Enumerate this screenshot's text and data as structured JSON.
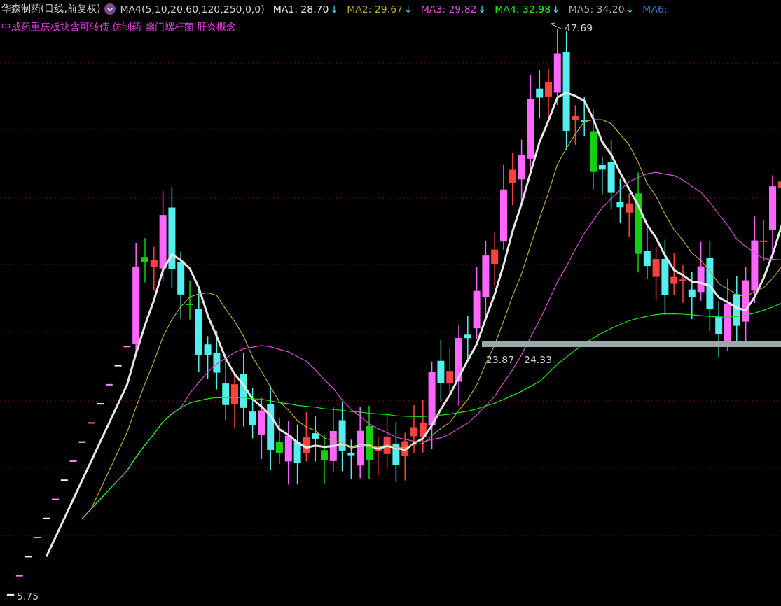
{
  "header": {
    "title": "华森制药(日线,前复权)",
    "indicator": "MA4(5,10,20,60,120,250,0,0)",
    "moving_averages": [
      {
        "label": "MA1: 28.70",
        "color": "#e6e6e6",
        "arrow": "↓"
      },
      {
        "label": "MA2: 29.67",
        "color": "#b5a83a",
        "arrow": "↓"
      },
      {
        "label": "MA3: 29.82",
        "color": "#d050d0",
        "arrow": "↓"
      },
      {
        "label": "MA4: 32.98",
        "color": "#19e619",
        "arrow": "↓"
      },
      {
        "label": "MA5: 34.20",
        "color": "#a8a8b8",
        "arrow": "↓"
      },
      {
        "label": "MA6:",
        "color": "#3d6fc8"
      }
    ]
  },
  "concepts": "中成药重庆板块含可转债 仿制药 幽门螺杆菌 肝炎概念",
  "chart": {
    "high_label": "47.69",
    "low_label": "5.75",
    "range_label": "23.87 - 24.33"
  }
}
